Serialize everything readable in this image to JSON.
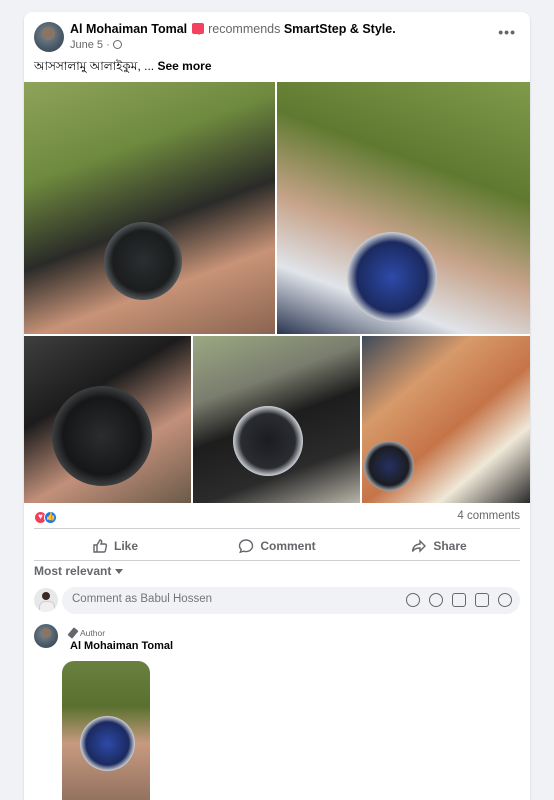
{
  "post": {
    "author": "Al Mohaiman Tomal",
    "recommends_text": "recommends",
    "page_name": "SmartStep & Style.",
    "date": "June 5 ·",
    "text": "আসসালামু আলাইকুম, ... ",
    "see_more": "See more",
    "menu_label": "•••"
  },
  "photos": [
    "watch-photo-1",
    "watch-photo-2",
    "watch-photo-3",
    "watch-photo-4",
    "watch-photo-5"
  ],
  "engagement": {
    "reactions": [
      "love-icon",
      "like-icon"
    ],
    "comments_count": "4 comments"
  },
  "actions": {
    "like": "Like",
    "comment": "Comment",
    "share": "Share"
  },
  "comments_section": {
    "sort_label": "Most relevant",
    "input_placeholder": "Comment as Babul Hossen",
    "input_icons": [
      "avatar-sticker-icon",
      "emoji-icon",
      "camera-icon",
      "gif-icon",
      "sticker-icon"
    ]
  },
  "comment": {
    "badge": "Author",
    "author": "Al Mohaiman Tomal"
  },
  "colors": {
    "accent": "#1877f2",
    "love": "#f33e58",
    "badge": "#f3425f",
    "muted_text": "#65676b"
  }
}
